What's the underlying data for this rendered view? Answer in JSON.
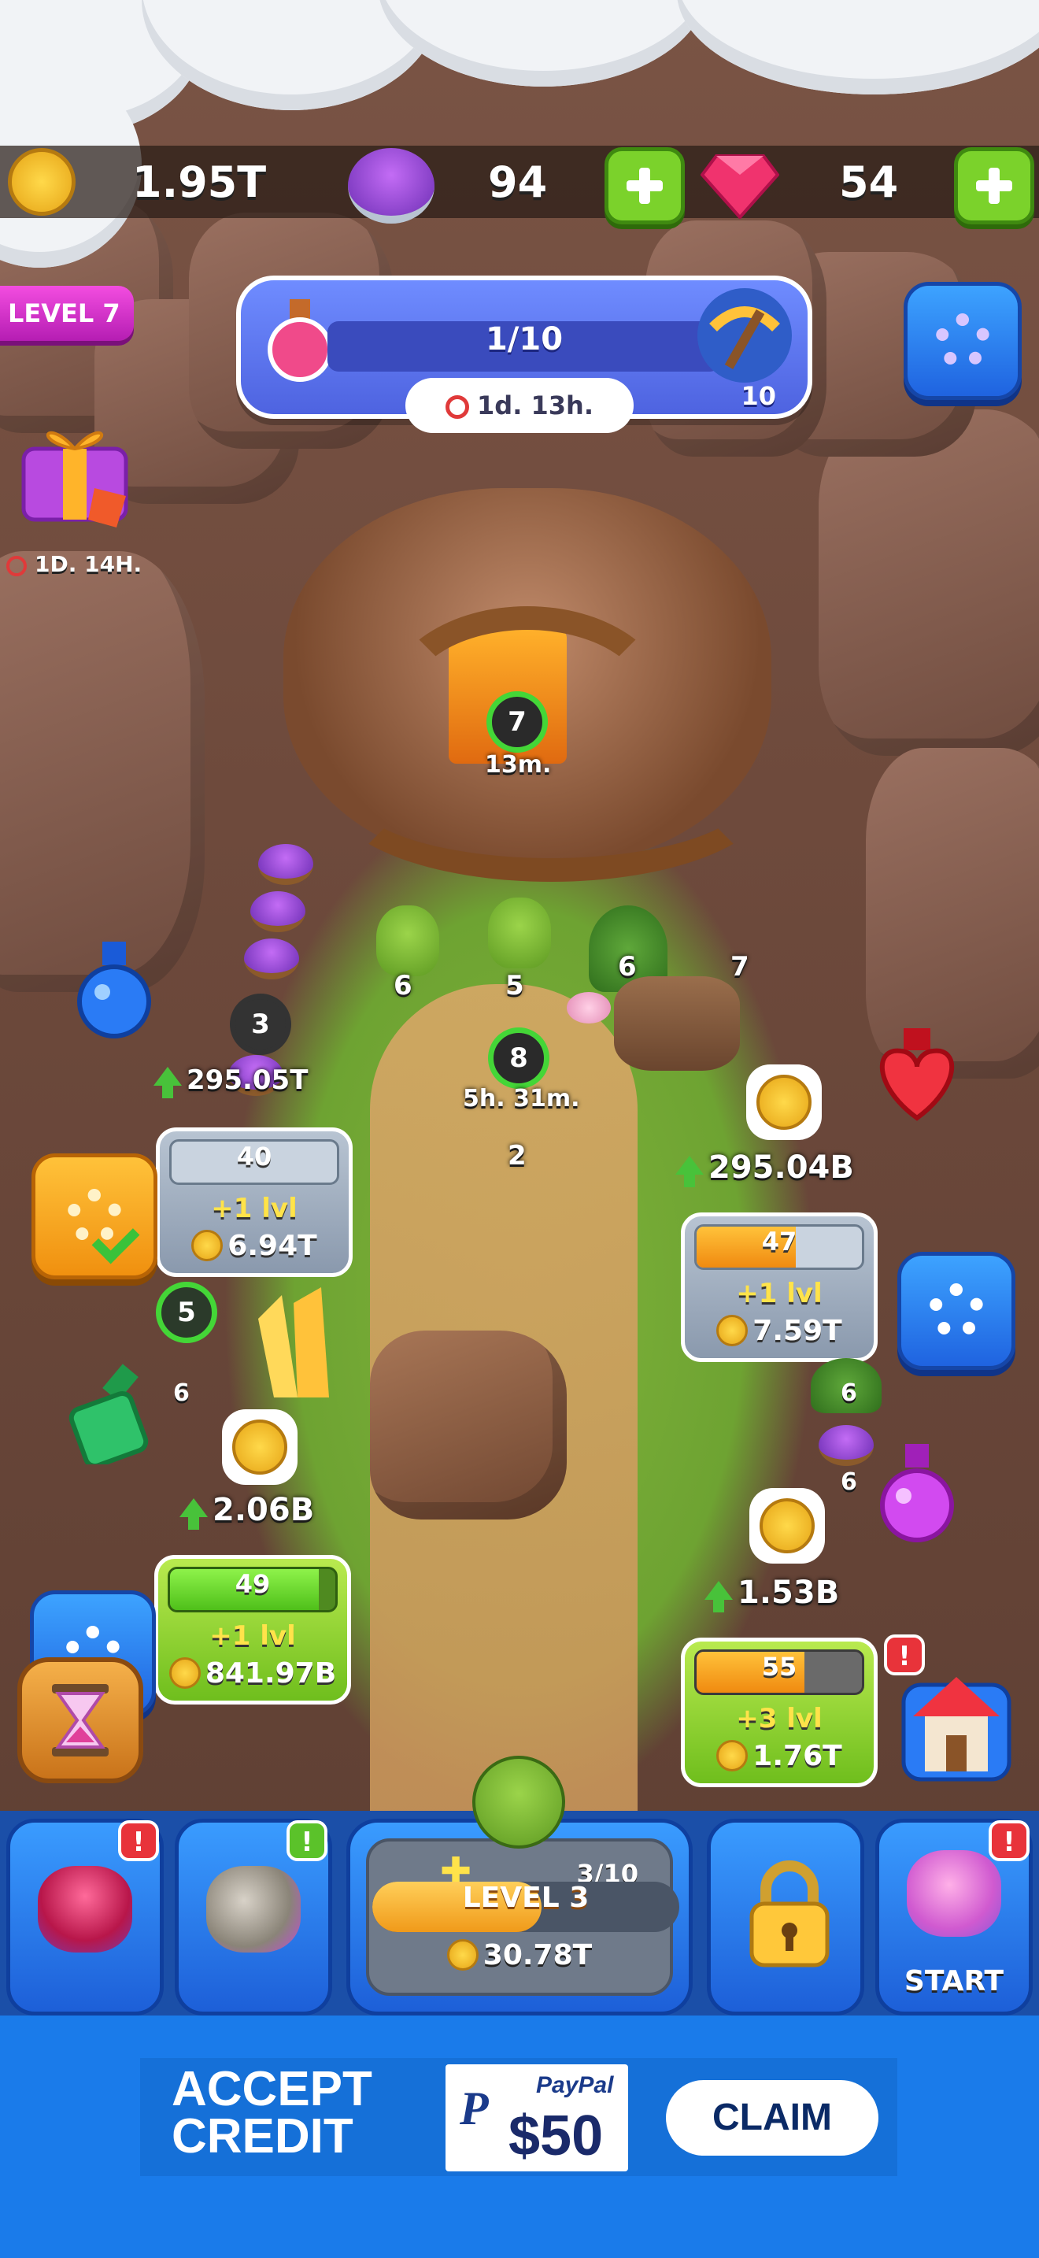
{
  "currencies": {
    "coins": "1.95T",
    "gems_purple": "94",
    "rubies": "54"
  },
  "level_tag": "LEVEL 7",
  "quest": {
    "progress": "1/10",
    "reward_count": "10",
    "timer": "1d. 13h."
  },
  "gift": {
    "timer": "1D. 14H."
  },
  "mine": {
    "main_ring": "7",
    "main_timer": "13m."
  },
  "workers": [
    {
      "label": "6"
    },
    {
      "label": "5"
    },
    {
      "label": "6"
    },
    {
      "label": "7"
    }
  ],
  "center_ring": {
    "value": "8",
    "timer": "5h. 31m."
  },
  "center_worker": "2",
  "left_pile_ring": "3",
  "left_income": "295.05T",
  "right_income_top": "295.04B",
  "left_income_mid": "2.06B",
  "right_income_bottom": "1.53B",
  "left_ring_mid": "5",
  "labels_small": {
    "left_six": "6",
    "right_six_top": "6",
    "right_six_bottom": "6"
  },
  "cards": [
    {
      "level": "40",
      "gain": "+1 lvl",
      "cost": "6.94T",
      "fill": 0
    },
    {
      "level": "47",
      "gain": "+1 lvl",
      "cost": "7.59T",
      "fill": 0.6
    },
    {
      "level": "49",
      "gain": "+1 lvl",
      "cost": "841.97B",
      "fill": 0.9
    },
    {
      "level": "55",
      "gain": "+3 lvl",
      "cost": "1.76T",
      "fill": 0.65
    }
  ],
  "notifications": {
    "shop": "!",
    "gems": "!",
    "potions": "!",
    "start": "!"
  },
  "bottom_nav": {
    "hero_progress": "3/10",
    "hero_level": "LEVEL 3",
    "hero_level_fill": 0.55,
    "hero_cost": "30.78T",
    "start_label": "START"
  },
  "ad": {
    "line1": "ACCEPT",
    "line2": "CREDIT",
    "brand": "PayPal",
    "amount": "$50",
    "cta": "CLAIM"
  },
  "colors": {
    "accent_green": "#44d637",
    "card_orange": "#f08a10",
    "nav_blue": "#1d5fd8",
    "ad_blue": "#1a7bea"
  }
}
